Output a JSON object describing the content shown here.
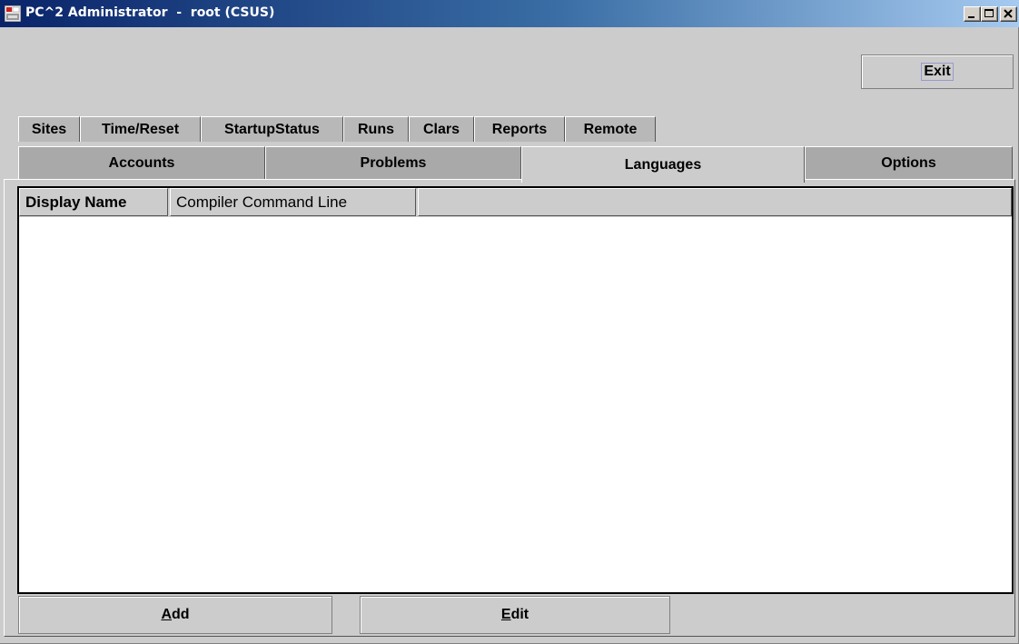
{
  "window": {
    "title": "PC^2 Administrator  -  root (CSUS)",
    "icon": "pc2-app-icon",
    "controls": [
      "minimize-icon",
      "maximize-icon",
      "close-icon"
    ]
  },
  "toolbar": {
    "exit_label": "Exit"
  },
  "tabs_top": [
    {
      "label": "Sites"
    },
    {
      "label": "Time/Reset"
    },
    {
      "label": "StartupStatus"
    },
    {
      "label": "Runs"
    },
    {
      "label": "Clars"
    },
    {
      "label": "Reports"
    },
    {
      "label": "Remote"
    }
  ],
  "tabs_bottom": [
    {
      "label": "Accounts"
    },
    {
      "label": "Problems"
    },
    {
      "label": "Languages",
      "selected": true
    },
    {
      "label": "Options"
    }
  ],
  "table": {
    "columns": [
      "Display Name",
      "Compiler Command Line",
      ""
    ],
    "rows": []
  },
  "buttons": {
    "add": {
      "mnemonic": "A",
      "rest": "dd"
    },
    "edit": {
      "mnemonic": "E",
      "rest": "dit"
    }
  }
}
